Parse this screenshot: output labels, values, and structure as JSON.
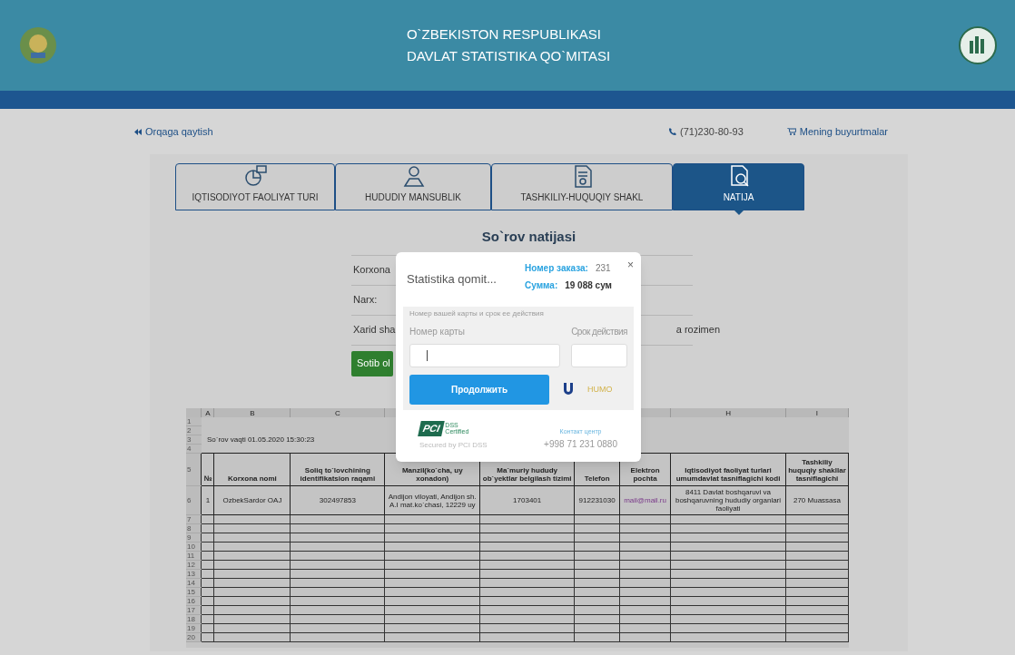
{
  "header": {
    "title_lines": [
      "O`ZBEKISTON RESPUBLIKASI",
      "DAVLAT STATISTIKA QO`MITASI"
    ]
  },
  "nav": {
    "back_link": "Orqaga qaytish",
    "phone": "(71)230-80-93",
    "orders_link": "Mening buyurtmalar"
  },
  "tabs": [
    {
      "label": "IQTISODIYOT FAOLIYAT TURI",
      "kind": "chart",
      "selected": false
    },
    {
      "label": "HUDUDIY MANSUBLIK",
      "kind": "map",
      "selected": false
    },
    {
      "label": "TASHKILIY-HUQUQIY SHAKL",
      "kind": "doc",
      "selected": false
    },
    {
      "label": "NATIJA",
      "kind": "search",
      "selected": true
    }
  ],
  "result": {
    "title": "So`rov natijasi",
    "rows": [
      {
        "label": "Korxona"
      },
      {
        "label": "Narx:"
      },
      {
        "label": "Xarid sha",
        "value": "a rozimen"
      }
    ],
    "buy_button": "Sotib ol"
  },
  "payment_dialog": {
    "merchant": "Statistika qomit...",
    "order_label": "Номер заказа:",
    "order_number": "231",
    "sum_label": "Сумма:",
    "sum": "19 088 сум",
    "close": "×",
    "hint": "Номер вашей карты и срок ее действия",
    "card_label": "Номер карты",
    "expiry_label": "Срок действия",
    "submit": "Продолжить",
    "brand": "HUMO",
    "pci_mark": "PCI",
    "pci_caption": "DSS Certified",
    "secured": "Secured by PCI DSS",
    "contact_label": "Контакт центр",
    "contact_phone": "+998 71 231 0880"
  },
  "spreadsheet": {
    "column_letters_left": [
      "A",
      "B",
      "C"
    ],
    "column_letters_right": [
      "H",
      "I"
    ],
    "title": "So`rov vaqti 01.05.2020 15:30:23",
    "headers": [
      "№",
      "Korxona nomi",
      "Soliq to`lovchining identifikatsion raqami",
      "Manzil(ko`cha, uy xonadon)",
      "Ma`muriy hududy ob`yektlar belgilash tizimi",
      "Telefon",
      "Elektron pochta",
      "Iqtisodiyot faoliyat turlari umumdavlat tasniflagichi kodi",
      "Tashkiliy huquqiy shakllar tasniflagichi"
    ],
    "rows": [
      [
        "1",
        "OzbekSardor OAJ",
        "302497853",
        "Andijon viloyati, Andijon sh. A.I mat.ko`chasi, 12229 uy",
        "1703401",
        "912231030",
        "mail@mail.ru",
        "8411 Davlat boshqaruvi va boshqaruvning hududiy organlari faoliyati",
        "270 Muassasa"
      ]
    ],
    "row_numbers": [
      "1",
      "2",
      "3",
      "4",
      "5",
      "6",
      "7",
      "8",
      "9",
      "10",
      "11",
      "12",
      "13",
      "14",
      "15",
      "16",
      "17",
      "18",
      "19",
      "20"
    ]
  }
}
